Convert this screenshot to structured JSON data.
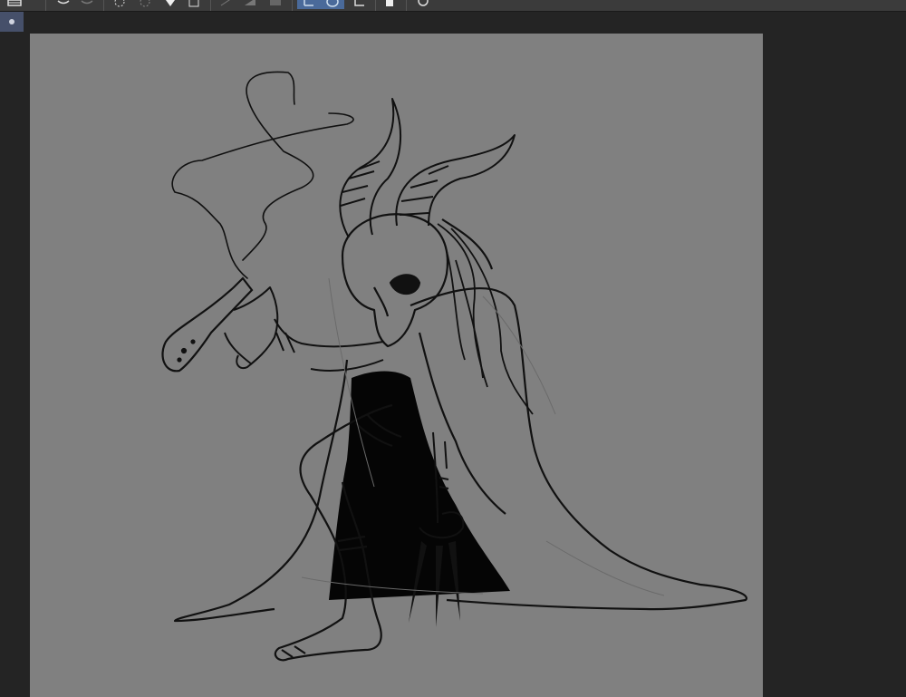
{
  "toolbar": {
    "buttons": [
      {
        "name": "layer-icon"
      },
      {
        "name": "undo-icon"
      },
      {
        "name": "redo-icon"
      },
      {
        "name": "clear-icon"
      },
      {
        "name": "fill-icon"
      },
      {
        "name": "color-icon"
      },
      {
        "name": "transform-icon"
      },
      {
        "name": "ruler-icon"
      },
      {
        "name": "gradient-icon"
      },
      {
        "name": "selection-icon"
      },
      {
        "name": "lasso-icon"
      },
      {
        "name": "crop-icon"
      },
      {
        "name": "device-icon"
      },
      {
        "name": "speech-icon"
      }
    ]
  },
  "tabs": {
    "active_index": 0
  },
  "canvas": {
    "background": "#808080",
    "artwork": "horned-creature-sketch"
  }
}
